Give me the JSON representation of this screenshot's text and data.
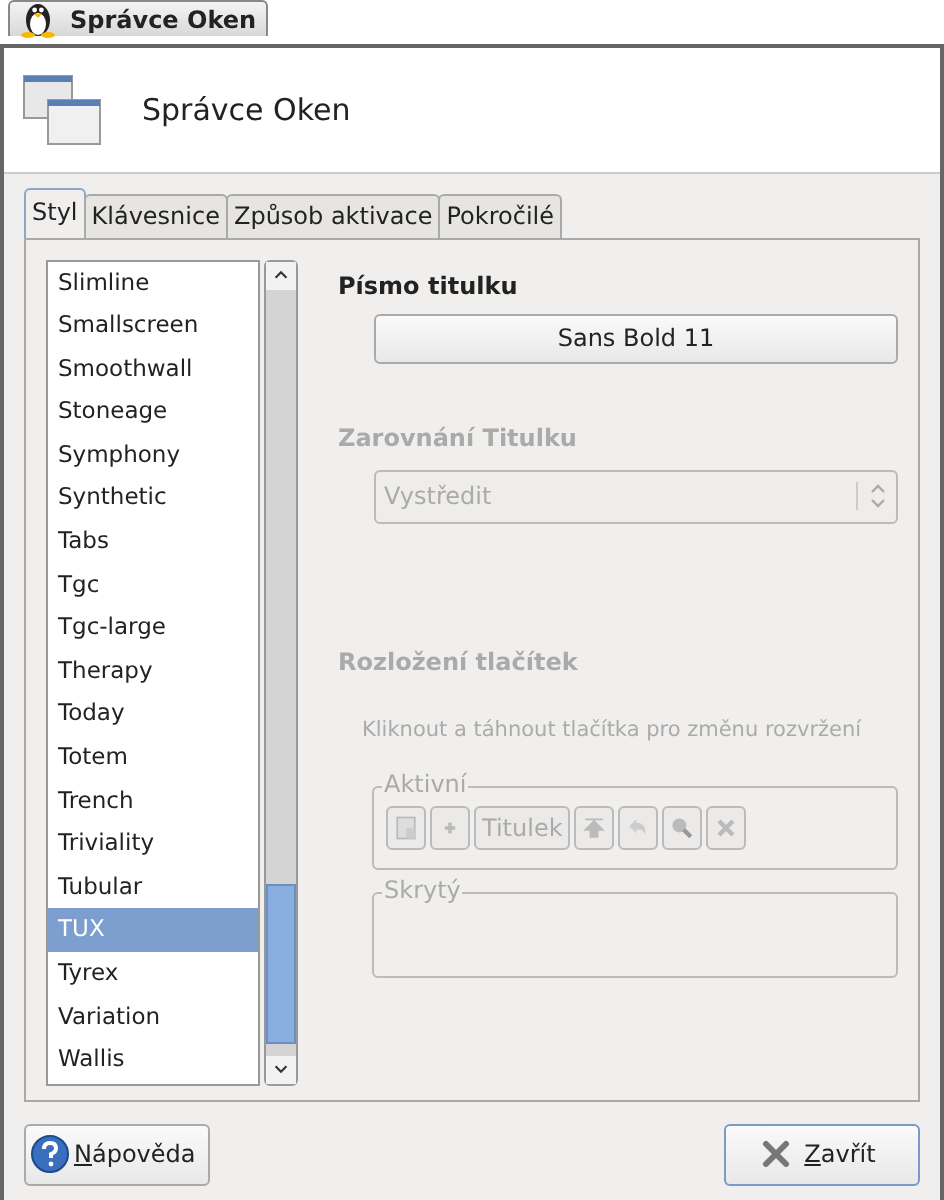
{
  "window": {
    "title": "Správce Oken"
  },
  "header": {
    "title": "Správce Oken"
  },
  "tabs": [
    {
      "label": "Styl",
      "selected": true
    },
    {
      "label": "Klávesnice",
      "selected": false
    },
    {
      "label": "Způsob aktivace",
      "selected": false
    },
    {
      "label": "Pokročilé",
      "selected": false
    }
  ],
  "themes": [
    {
      "name": "Slimline",
      "selected": false
    },
    {
      "name": "Smallscreen",
      "selected": false
    },
    {
      "name": "Smoothwall",
      "selected": false
    },
    {
      "name": "Stoneage",
      "selected": false
    },
    {
      "name": "Symphony",
      "selected": false
    },
    {
      "name": "Synthetic",
      "selected": false
    },
    {
      "name": "Tabs",
      "selected": false
    },
    {
      "name": "Tgc",
      "selected": false
    },
    {
      "name": "Tgc-large",
      "selected": false
    },
    {
      "name": "Therapy",
      "selected": false
    },
    {
      "name": "Today",
      "selected": false
    },
    {
      "name": "Totem",
      "selected": false
    },
    {
      "name": "Trench",
      "selected": false
    },
    {
      "name": "Triviality",
      "selected": false
    },
    {
      "name": "Tubular",
      "selected": false
    },
    {
      "name": "TUX",
      "selected": true
    },
    {
      "name": "Tyrex",
      "selected": false
    },
    {
      "name": "Variation",
      "selected": false
    },
    {
      "name": "Wallis",
      "selected": false
    }
  ],
  "title_font": {
    "heading": "Písmo titulku",
    "value": "Sans Bold 11",
    "disabled": false
  },
  "title_alignment": {
    "heading": "Zarovnání Titulku",
    "value": "Vystředit",
    "disabled": true
  },
  "button_layout": {
    "heading": "Rozložení tlačítek",
    "hint": "Kliknout a táhnout tlačítka pro změnu rozvržení",
    "disabled": true,
    "active": {
      "label": "Aktivní",
      "buttons": [
        {
          "kind": "menu"
        },
        {
          "kind": "stick"
        },
        {
          "kind": "title",
          "label": "Titulek"
        },
        {
          "kind": "above"
        },
        {
          "kind": "shade"
        },
        {
          "kind": "help"
        },
        {
          "kind": "close"
        }
      ]
    },
    "hidden": {
      "label": "Skrytý"
    }
  },
  "footer": {
    "help": "Nápověda",
    "close": "Zavřít"
  }
}
